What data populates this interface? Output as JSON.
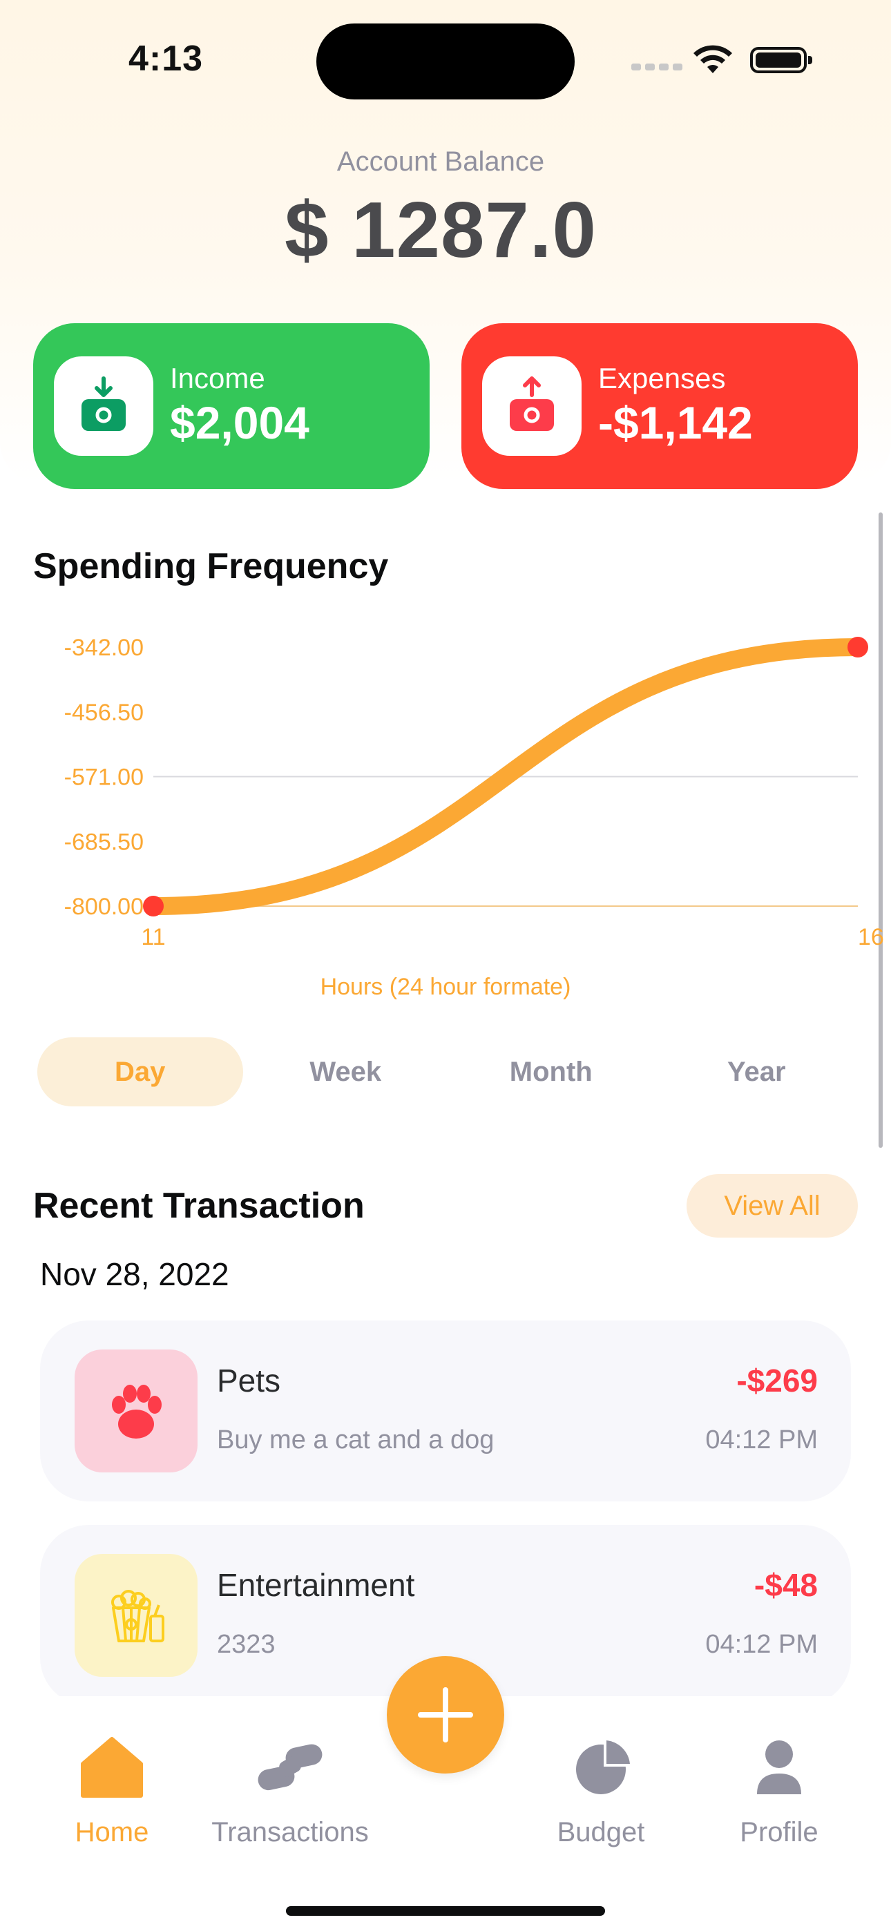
{
  "status_bar": {
    "time": "4:13"
  },
  "balance": {
    "label": "Account Balance",
    "value": "$ 1287.0"
  },
  "summary": {
    "income": {
      "label": "Income",
      "value": "$2,004",
      "icon": "income-wallet-icon"
    },
    "expenses": {
      "label": "Expenses",
      "value": "-$1,142",
      "icon": "expense-wallet-icon"
    }
  },
  "spending": {
    "title": "Spending Frequency",
    "xlabel": "Hours (24 hour formate)"
  },
  "chart_data": {
    "type": "line",
    "title": "Spending Frequency",
    "xlabel": "Hours (24 hour formate)",
    "ylabel": "",
    "x": [
      11,
      16
    ],
    "x_tick_labels": [
      "11",
      "16"
    ],
    "y_tick_labels": [
      "-342.00",
      "-456.50",
      "-571.00",
      "-685.50",
      "-800.00"
    ],
    "ylim": [
      -800,
      -342
    ],
    "series": [
      {
        "values": [
          -800,
          -342
        ]
      }
    ],
    "colors": {
      "line": "#fba834",
      "points": "#ff3b30",
      "axis_text": "#fba834"
    },
    "grid": true
  },
  "periods": {
    "day": "Day",
    "week": "Week",
    "month": "Month",
    "year": "Year",
    "active": "Day"
  },
  "recent": {
    "title": "Recent Transaction",
    "view_all": "View All",
    "date": "Nov 28, 2022",
    "items": [
      {
        "name": "Pets",
        "description": "Buy me a cat and a dog",
        "amount": "-$269",
        "time": "04:12 PM",
        "icon": "paw-icon",
        "icon_bg": "#fbd0db",
        "icon_color": "#fd3c4a"
      },
      {
        "name": "Entertainment",
        "description": "2323",
        "amount": "-$48",
        "time": "04:12 PM",
        "icon": "popcorn-icon",
        "icon_bg": "#fcf3c7",
        "icon_color": "#fcce1f"
      }
    ]
  },
  "tabbar": {
    "home": "Home",
    "transactions": "Transactions",
    "budget": "Budget",
    "profile": "Profile",
    "active": "Home"
  },
  "theme": {
    "accent": "#fba834",
    "income": "#34c759",
    "expense": "#ff3b30"
  }
}
